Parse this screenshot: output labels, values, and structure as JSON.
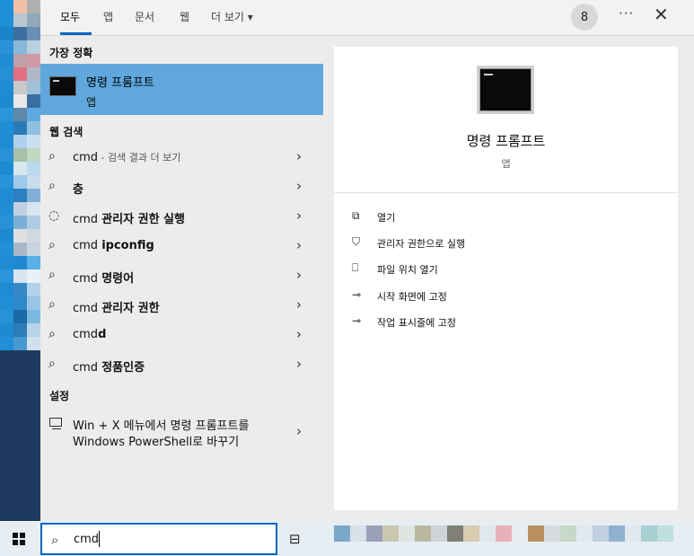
{
  "tabs": [
    {
      "label": "모두"
    },
    {
      "label": "앱"
    },
    {
      "label": "문서"
    },
    {
      "label": "웹"
    },
    {
      "label": "더 보기 ▾"
    }
  ],
  "header": {
    "badge": "8",
    "more": "···",
    "close": "✕"
  },
  "best_match": {
    "heading": "가장 정확",
    "name": "명령 프롬프트",
    "kind": "앱"
  },
  "web": {
    "heading": "웹 검색",
    "items": [
      {
        "prefix": "cmd",
        "bold": "",
        "suffix": " - 검색 결과 더 보기"
      },
      {
        "prefix": "",
        "bold": "층",
        "suffix": ""
      },
      {
        "prefix": "cmd ",
        "bold": "관리자 권한 실행",
        "suffix": ""
      },
      {
        "prefix": "cmd ",
        "bold": "ipconfig",
        "suffix": ""
      },
      {
        "prefix": "cmd ",
        "bold": "명령어",
        "suffix": ""
      },
      {
        "prefix": "cmd ",
        "bold": "관리자 권한",
        "suffix": ""
      },
      {
        "prefix": "cmd",
        "bold": "d",
        "suffix": ""
      },
      {
        "prefix": "cmd ",
        "bold": "정품인증",
        "suffix": ""
      }
    ]
  },
  "settings": {
    "heading": "설정",
    "line1": "Win + X 메뉴에서 명령 프롬프트를",
    "line2": "Windows PowerShell로 바꾸기"
  },
  "detail": {
    "title": "명령 프롬프트",
    "kind": "앱",
    "actions": [
      {
        "icon": "open-icon",
        "glyph": "⧉",
        "label": "열기"
      },
      {
        "icon": "shield-icon",
        "glyph": "⛉",
        "label": "관리자 권한으로 실행"
      },
      {
        "icon": "file-location-icon",
        "glyph": "⎕",
        "label": "파일 위치 열기"
      },
      {
        "icon": "pin-icon",
        "glyph": "⊸",
        "label": "시작 화면에 고정"
      },
      {
        "icon": "pin-icon",
        "glyph": "⊸",
        "label": "작업 표시줄에 고정"
      }
    ]
  },
  "taskbar": {
    "search_value": "cmd"
  },
  "colors": {
    "accent": "#0067c0",
    "selected_row": "#5fa7dc"
  }
}
